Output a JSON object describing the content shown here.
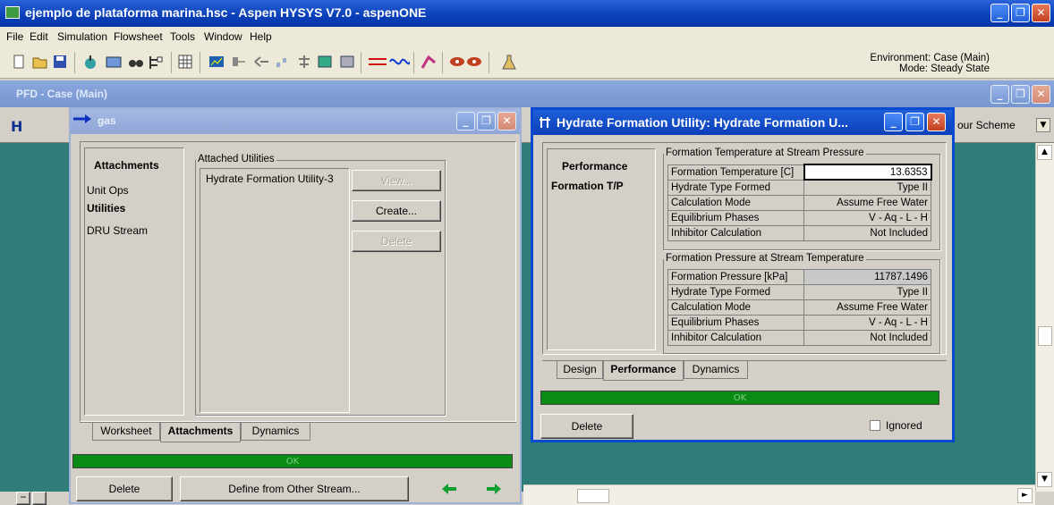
{
  "app": {
    "title": "ejemplo de plataforma marina.hsc - Aspen HYSYS V7.0 - aspenONE",
    "minimize": "_",
    "restore": "❐",
    "close": "✕"
  },
  "menu": [
    "File",
    "Edit",
    "Simulation",
    "Flowsheet",
    "Tools",
    "Window",
    "Help"
  ],
  "environment": {
    "line1": "Environment: Case (Main)",
    "line2": "Mode: Steady State"
  },
  "pfd": {
    "title": "PFD - Case (Main)",
    "scheme_label": "our Scheme"
  },
  "gas_window": {
    "title": "gas",
    "nav_header": "Attachments",
    "nav_items": [
      "Unit Ops",
      "Utilities",
      "DRU Stream"
    ],
    "group_label": "Attached Utilities",
    "attached_list": [
      "Hydrate Formation Utility-3"
    ],
    "buttons": {
      "view": "View...",
      "create": "Create...",
      "delete": "Delete"
    },
    "tabs": [
      "Worksheet",
      "Attachments",
      "Dynamics"
    ],
    "status": "OK",
    "footer": {
      "delete": "Delete",
      "define": "Define from Other Stream..."
    }
  },
  "hydrate_window": {
    "title": "Hydrate Formation Utility: Hydrate Formation U...",
    "nav_header": "Performance",
    "nav_items": [
      "Formation T/P"
    ],
    "group1": {
      "label": "Formation Temperature at Stream Pressure",
      "rows": [
        {
          "k": "Formation Temperature [C]",
          "v": "13.6353"
        },
        {
          "k": "Hydrate Type Formed",
          "v": "Type II"
        },
        {
          "k": "Calculation Mode",
          "v": "Assume Free Water"
        },
        {
          "k": "Equilibrium Phases",
          "v": "V - Aq - L - H"
        },
        {
          "k": "Inhibitor Calculation",
          "v": "Not Included"
        }
      ]
    },
    "group2": {
      "label": "Formation Pressure at Stream Temperature",
      "rows": [
        {
          "k": "Formation Pressure [kPa]",
          "v": "11787.1496"
        },
        {
          "k": "Hydrate Type Formed",
          "v": "Type II"
        },
        {
          "k": "Calculation Mode",
          "v": "Assume Free Water"
        },
        {
          "k": "Equilibrium Phases",
          "v": "V - Aq - L - H"
        },
        {
          "k": "Inhibitor Calculation",
          "v": "Not Included"
        }
      ]
    },
    "tabs": [
      "Design",
      "Performance",
      "Dynamics"
    ],
    "status": "OK",
    "footer": {
      "delete": "Delete",
      "ignored": "Ignored"
    }
  }
}
